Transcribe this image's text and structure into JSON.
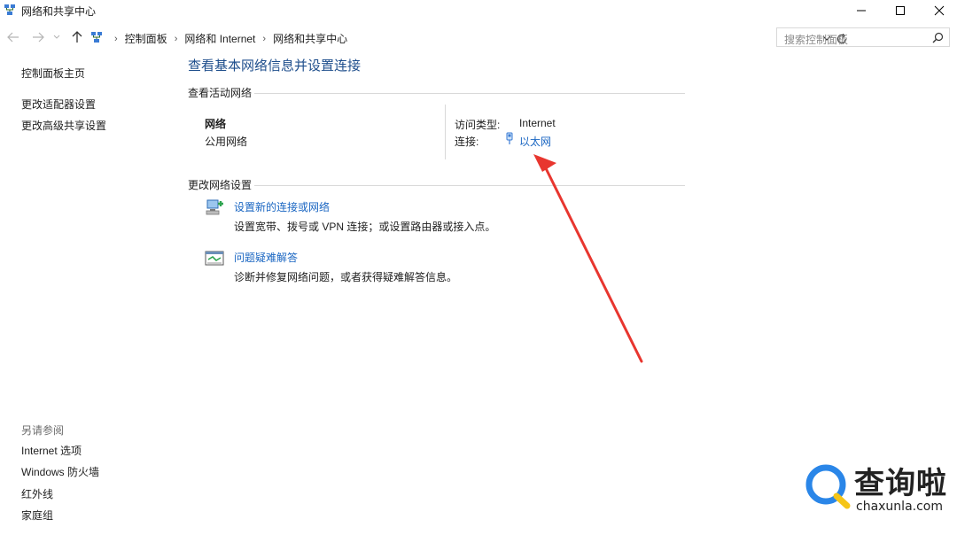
{
  "window": {
    "title": "网络和共享中心"
  },
  "address_bar": {
    "crumbs": [
      "控制面板",
      "网络和 Internet",
      "网络和共享中心"
    ],
    "search_placeholder": "搜索控制面板"
  },
  "sidebar": {
    "home": "控制面板主页",
    "items": [
      "更改适配器设置",
      "更改高级共享设置"
    ],
    "see_also_heading": "另请参阅",
    "see_also": [
      "Internet 选项",
      "Windows 防火墙",
      "红外线",
      "家庭组"
    ]
  },
  "main": {
    "title": "查看基本网络信息并设置连接",
    "active_networks": {
      "heading": "查看活动网络",
      "network_name": "网络",
      "network_type": "公用网络",
      "access_type_label": "访问类型:",
      "access_type_value": "Internet",
      "connection_label": "连接:",
      "connection_value": "以太网"
    },
    "change_settings": {
      "heading": "更改网络设置",
      "tasks": [
        {
          "title": "设置新的连接或网络",
          "description": "设置宽带、拨号或 VPN 连接；或设置路由器或接入点。"
        },
        {
          "title": "问题疑难解答",
          "description": "诊断并修复网络问题，或者获得疑难解答信息。"
        }
      ]
    }
  },
  "watermark": {
    "chinese": "查询啦",
    "domain": "chaxunla.com"
  },
  "colors": {
    "link": "#1a66c2",
    "title": "#1e4e8c",
    "annotation_arrow": "#e8362f",
    "watermark_blue": "#2a86e8",
    "watermark_yellow": "#f5c518"
  }
}
